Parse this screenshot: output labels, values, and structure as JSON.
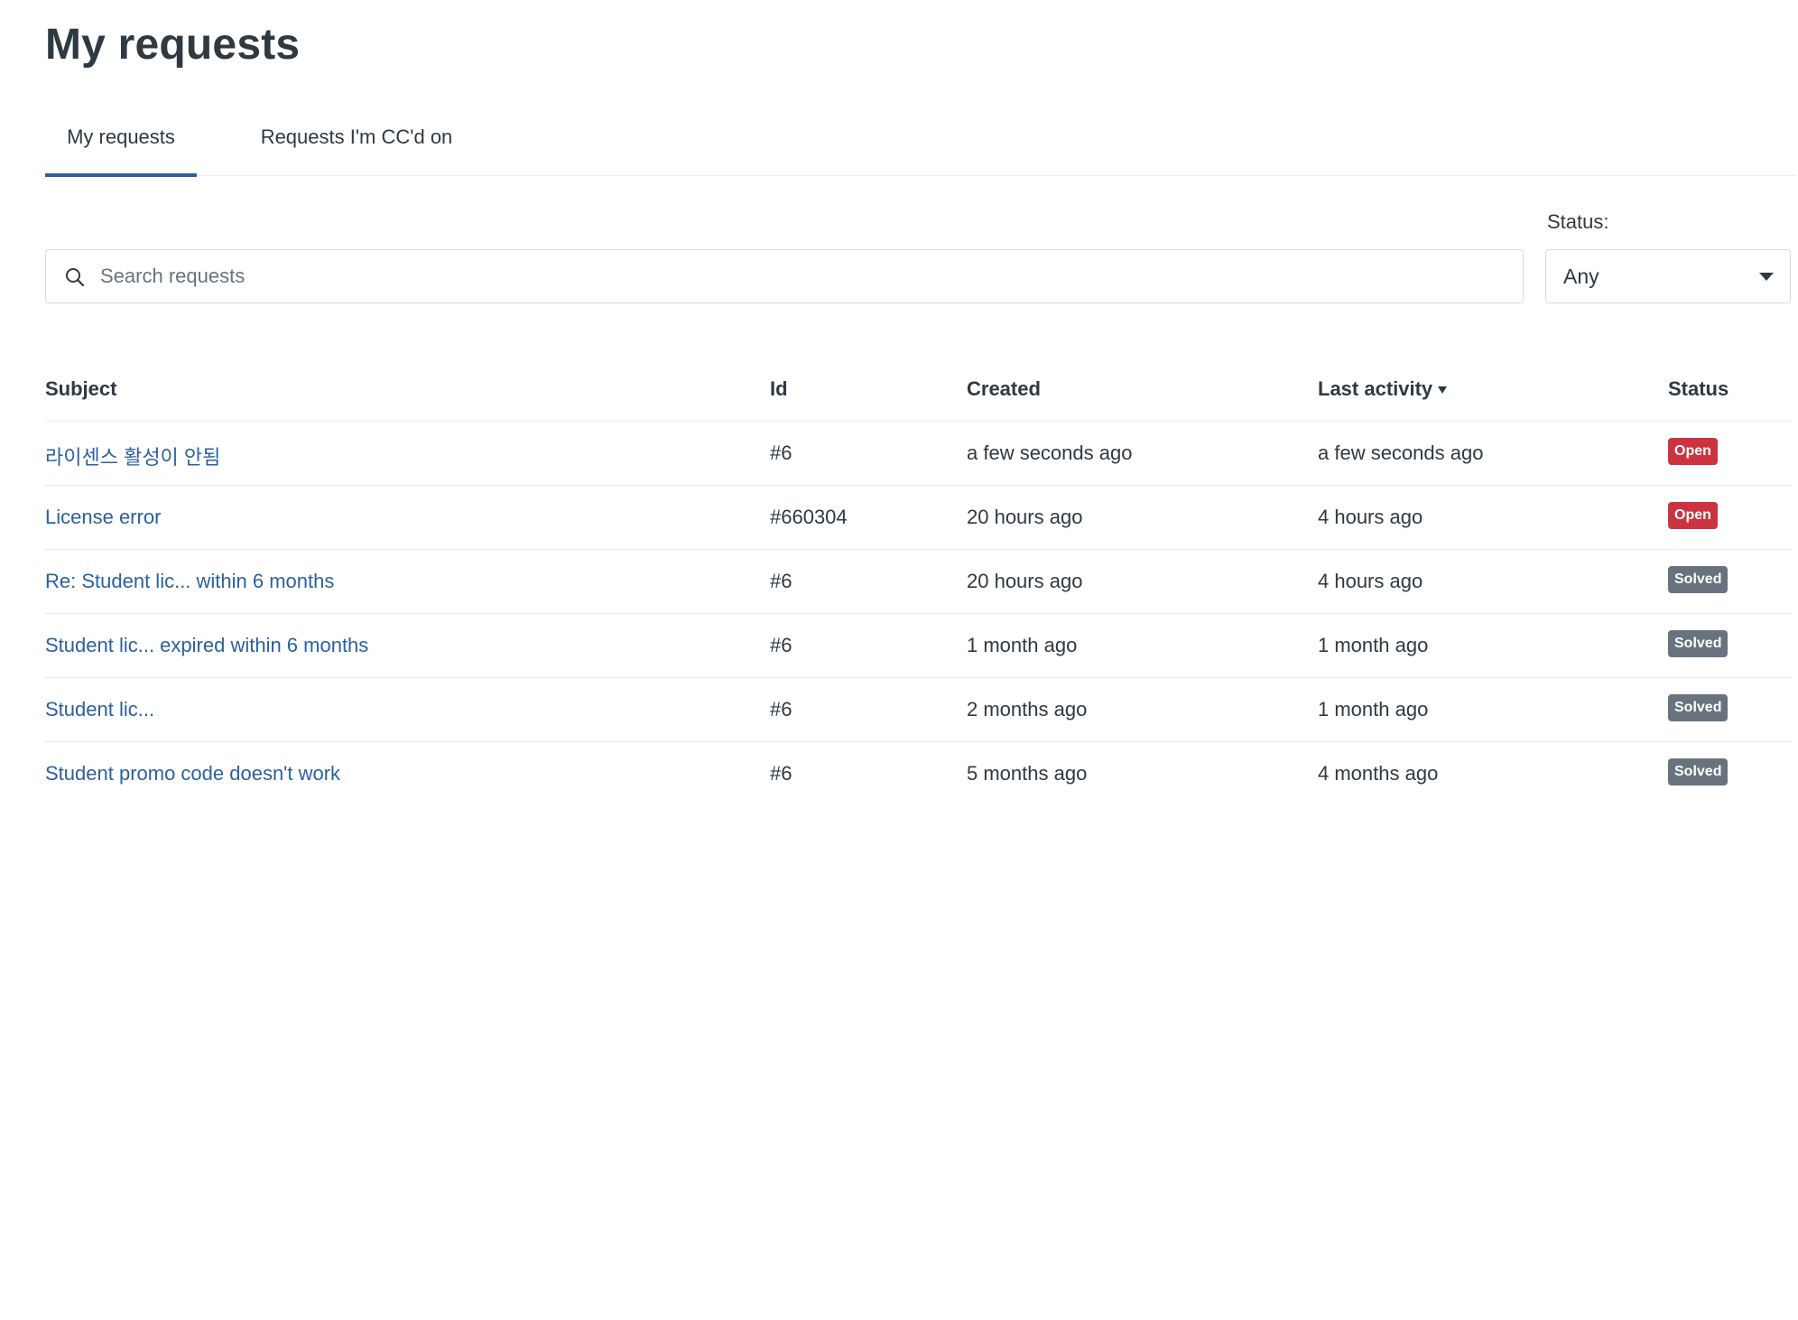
{
  "page": {
    "title": "My requests"
  },
  "tabs": [
    {
      "label": "My requests",
      "active": true
    },
    {
      "label": "Requests I'm CC'd on",
      "active": false
    }
  ],
  "filters": {
    "status_label": "Status:",
    "status_value": "Any",
    "search_placeholder": "Search requests"
  },
  "table": {
    "headers": {
      "subject": "Subject",
      "id": "Id",
      "created": "Created",
      "last_activity": "Last activity",
      "status": "Status"
    },
    "sort_column": "last_activity",
    "rows": [
      {
        "subject": "라이센스 활성이 안됨",
        "id": "#6",
        "created": "a few seconds ago",
        "last_activity": "a few seconds ago",
        "status": "Open"
      },
      {
        "subject": "License error",
        "id": "#660304",
        "created": "20 hours ago",
        "last_activity": "4 hours ago",
        "status": "Open"
      },
      {
        "subject": "Re: Student lic... within 6 months",
        "id": "#6",
        "created": "20 hours ago",
        "last_activity": "4 hours ago",
        "status": "Solved"
      },
      {
        "subject": "Student lic... expired within 6 months",
        "id": "#6",
        "created": "1 month ago",
        "last_activity": "1 month ago",
        "status": "Solved"
      },
      {
        "subject": "Student lic...",
        "id": "#6",
        "created": "2 months ago",
        "last_activity": "1 month ago",
        "status": "Solved"
      },
      {
        "subject": "Student promo code doesn't work",
        "id": "#6",
        "created": "5 months ago",
        "last_activity": "4 months ago",
        "status": "Solved"
      }
    ]
  },
  "colors": {
    "link": "#2c5fa0",
    "tab_indicator": "#2c5fa0",
    "badge_open": "#cc3340",
    "badge_solved": "#68737d",
    "text": "#2f3941",
    "border": "#e9ebed"
  }
}
